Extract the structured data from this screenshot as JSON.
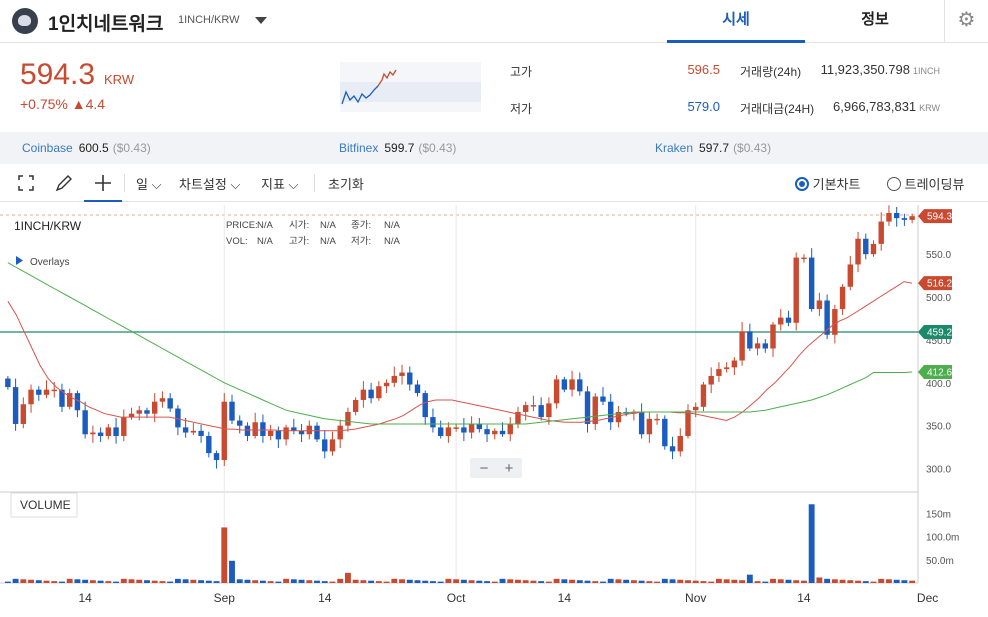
{
  "header": {
    "name": "1인치네트워크",
    "pair": "1INCH/KRW",
    "tabs": [
      "시세",
      "정보"
    ]
  },
  "price": {
    "value": "594.3",
    "currency": "KRW",
    "change_pct": "+0.75%",
    "change_abs": "▲4.4"
  },
  "stats": {
    "high_label": "고가",
    "high": "596.5",
    "low_label": "저가",
    "low": "579.0",
    "vol_label": "거래량(24h)",
    "vol": "11,923,350.798",
    "vol_unit": "1INCH",
    "amt_label": "거래대금(24H)",
    "amt": "6,966,783,831",
    "amt_unit": "KRW"
  },
  "exchanges": [
    {
      "name": "Coinbase",
      "price": "600.5",
      "usd": "($0.43)"
    },
    {
      "name": "Bitfinex",
      "price": "599.7",
      "usd": "($0.43)"
    },
    {
      "name": "Kraken",
      "price": "597.7",
      "usd": "($0.43)"
    }
  ],
  "toolbar": {
    "period": "일",
    "settings": "차트설정",
    "indicators": "지표",
    "reset": "초기화",
    "radio_basic": "기본차트",
    "radio_tv": "트레이딩뷰"
  },
  "colors": {
    "up": "#c84a31",
    "down": "#1a5dbf",
    "ma_fast": "#d9534f",
    "ma_slow": "#4cae4c",
    "hline": "#1b8a6b"
  },
  "chart_data": {
    "type": "candlestick",
    "title": "1INCH/KRW",
    "legend": {
      "price_label": "PRICE:",
      "price": "N/A",
      "open_label": "시가:",
      "open": "N/A",
      "close_label": "종가:",
      "close": "N/A",
      "vol_label": "VOL:",
      "vol": "N/A",
      "high_label": "고가:",
      "high": "N/A",
      "low_label": "저가:",
      "low": "N/A"
    },
    "overlays_label": "Overlays",
    "volume_label": "VOLUME",
    "price_ticks": [
      550,
      500,
      450,
      400,
      350,
      300
    ],
    "price_tick_labels": [
      "550.0",
      "500.0",
      "450.0",
      "400.0",
      "350.0",
      "300.0"
    ],
    "ylim": [
      275,
      605
    ],
    "volume_ticks": [
      150,
      100,
      50
    ],
    "volume_tick_labels": [
      "150m",
      "100.0m",
      "50.0m"
    ],
    "vlim": [
      0,
      190
    ],
    "x_labels": [
      {
        "i": 10,
        "t": "14"
      },
      {
        "i": 28,
        "t": "Sep"
      },
      {
        "i": 41,
        "t": "14"
      },
      {
        "i": 58,
        "t": "Oct"
      },
      {
        "i": 72,
        "t": "14"
      },
      {
        "i": 89,
        "t": "Nov"
      },
      {
        "i": 103,
        "t": "14"
      },
      {
        "i": 119,
        "t": "Dec"
      }
    ],
    "badges": [
      {
        "value": 594.3,
        "label": "594.3",
        "color": "#c84a31"
      },
      {
        "value": 516.2,
        "label": "516.2",
        "color": "#c84a31"
      },
      {
        "value": 459.2,
        "label": "459.2",
        "color": "#1b8a6b"
      },
      {
        "value": 412.6,
        "label": "412.6",
        "color": "#4cae4c"
      }
    ],
    "hline": 459.2,
    "closes": [
      395,
      352,
      375,
      392,
      386,
      392,
      392,
      372,
      388,
      368,
      340,
      342,
      338,
      348,
      338,
      360,
      364,
      368,
      364,
      378,
      382,
      370,
      348,
      342,
      344,
      338,
      318,
      310,
      378,
      356,
      350,
      338,
      354,
      338,
      344,
      334,
      348,
      344,
      340,
      350,
      334,
      320,
      334,
      350,
      366,
      380,
      392,
      382,
      396,
      400,
      408,
      412,
      398,
      388,
      360,
      348,
      338,
      348,
      348,
      342,
      352,
      346,
      340,
      344,
      340,
      352,
      366,
      374,
      374,
      360,
      376,
      404,
      392,
      404,
      390,
      352,
      384,
      378,
      354,
      366,
      364,
      366,
      340,
      358,
      358,
      326,
      320,
      338,
      368,
      372,
      398,
      408,
      416,
      418,
      426,
      460,
      440,
      446,
      440,
      468,
      476,
      470,
      546,
      546,
      486,
      496,
      456,
      486,
      512,
      538,
      568,
      550,
      562,
      588,
      598,
      592,
      590,
      594.3
    ],
    "ma_fast": [
      495,
      480,
      460,
      440,
      420,
      405,
      395,
      388,
      382,
      378,
      372,
      368,
      364,
      362,
      360,
      360,
      360,
      360,
      360,
      360,
      360,
      358,
      356,
      354,
      352,
      350,
      348,
      346,
      346,
      345,
      345,
      345,
      345,
      345,
      344,
      344,
      344,
      344,
      344,
      344,
      344,
      344,
      345,
      346,
      348,
      350,
      352,
      355,
      358,
      362,
      368,
      374,
      378,
      380,
      380,
      380,
      378,
      376,
      374,
      372,
      370,
      368,
      366,
      364,
      362,
      360,
      358,
      356,
      355,
      354,
      354,
      354,
      355,
      356,
      358,
      360,
      362,
      364,
      365,
      366,
      366,
      366,
      366,
      365,
      365,
      364,
      362,
      360,
      358,
      356,
      360,
      366,
      374,
      382,
      392,
      400,
      410,
      420,
      432,
      442,
      450,
      458,
      466,
      472,
      476,
      482,
      488,
      494,
      500,
      506,
      512,
      518,
      516
    ],
    "ma_slow": [
      540,
      535,
      530,
      525,
      520,
      515,
      510,
      505,
      500,
      495,
      490,
      485,
      480,
      475,
      470,
      465,
      460,
      455,
      450,
      445,
      440,
      435,
      430,
      425,
      420,
      415,
      410,
      405,
      400,
      396,
      392,
      388,
      384,
      380,
      376,
      372,
      368,
      366,
      364,
      362,
      360,
      358,
      357,
      356,
      355,
      354,
      353,
      352,
      352,
      352,
      352,
      352,
      352,
      352,
      352,
      352,
      352,
      352,
      352,
      352,
      352,
      352,
      352,
      352,
      352,
      352,
      352,
      352,
      353,
      354,
      355,
      356,
      357,
      358,
      359,
      360,
      361,
      362,
      363,
      364,
      365,
      366,
      366,
      366,
      366,
      366,
      366,
      366,
      366,
      366,
      366,
      366,
      366,
      366,
      366,
      366,
      366,
      367,
      368,
      370,
      372,
      374,
      376,
      378,
      380,
      383,
      386,
      390,
      394,
      398,
      402,
      406,
      412,
      412,
      412,
      412,
      412,
      412.6
    ]
  }
}
